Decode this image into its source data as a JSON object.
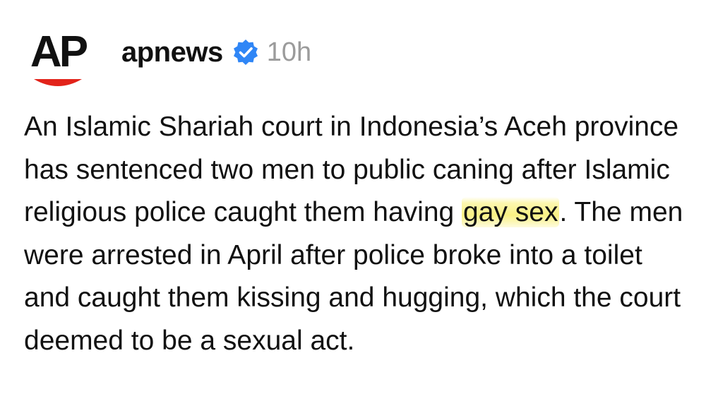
{
  "post": {
    "avatar_label": "AP",
    "username": "apnews",
    "verified_icon": "verified-badge-icon",
    "timestamp": "10h",
    "caption": {
      "part1": "An Islamic Shariah court in Indonesia’s Aceh province has sentenced two men to public caning after Islamic religious police caught them having ",
      "highlighted": "gay sex",
      "part2": ". The men were arrested in April after police broke into a toilet and caught them kissing and hugging, which the court deemed to be a sexual act."
    }
  },
  "colors": {
    "text": "#111111",
    "timestamp": "#9b9b9b",
    "verified_badge": "#2f86f6",
    "ap_logo_red": "#e2231a",
    "highlight": "#f7ec5a"
  }
}
